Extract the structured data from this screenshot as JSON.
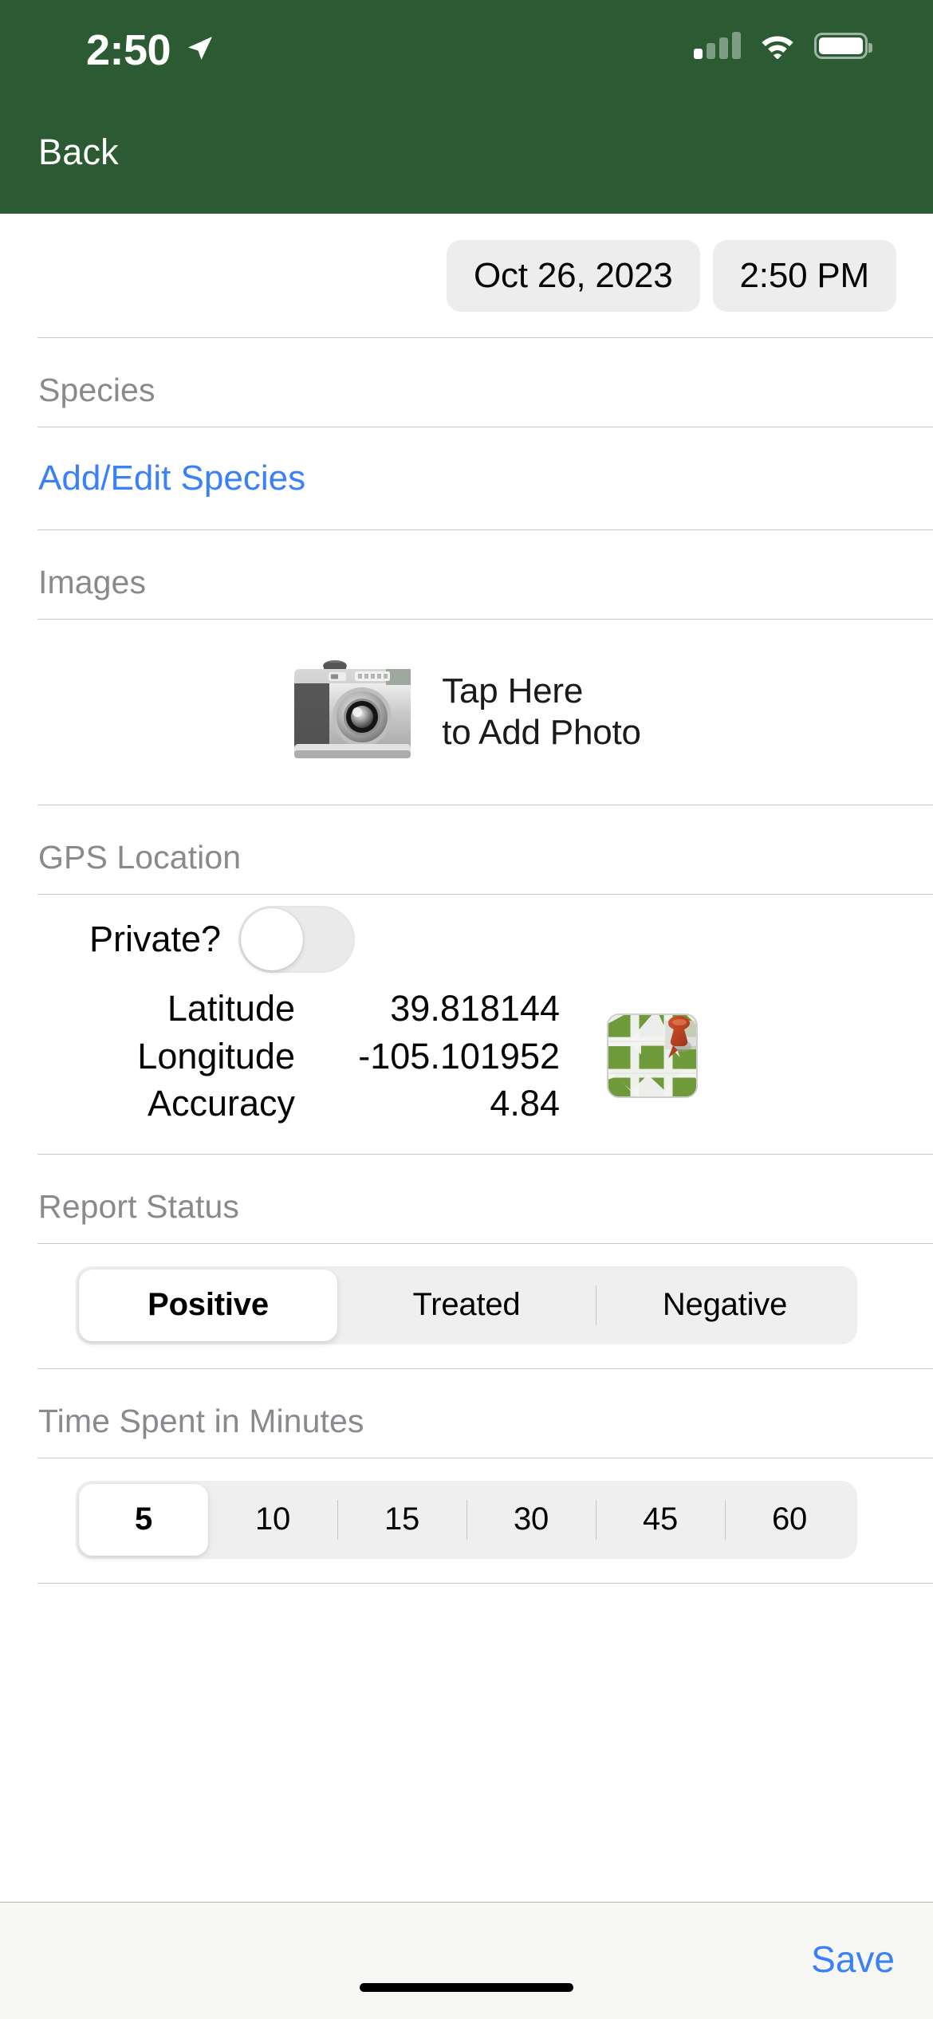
{
  "status_bar": {
    "time": "2:50",
    "location_arrow_icon": "location-arrow-icon",
    "signal_icon": "cellular-signal-icon",
    "signal_bars_active": 1,
    "signal_bars_total": 4,
    "wifi_icon": "wifi-icon",
    "battery_icon": "battery-icon",
    "battery_level_percent": 100
  },
  "nav": {
    "back_label": "Back",
    "bar_color": "#2C5B33"
  },
  "datetime": {
    "date_value": "Oct 26, 2023",
    "time_value": "2:50 PM"
  },
  "species": {
    "section_label": "Species",
    "add_edit_link": "Add/Edit Species"
  },
  "images": {
    "section_label": "Images",
    "camera_icon": "camera-icon",
    "tap_line1": "Tap Here",
    "tap_line2": "to Add Photo"
  },
  "gps": {
    "section_label": "GPS Location",
    "private_label": "Private?",
    "private_on": false,
    "rows": [
      {
        "key": "Latitude",
        "value": "39.818144"
      },
      {
        "key": "Longitude",
        "value": "-105.101952"
      },
      {
        "key": "Accuracy",
        "value": "4.84"
      }
    ],
    "map_icon": "map-pin-icon"
  },
  "report_status": {
    "section_label": "Report Status",
    "options": [
      "Positive",
      "Treated",
      "Negative"
    ],
    "selected": "Positive"
  },
  "time_spent": {
    "section_label": "Time Spent in Minutes",
    "options": [
      "5",
      "10",
      "15",
      "30",
      "45",
      "60"
    ],
    "selected": "5"
  },
  "footer": {
    "save_label": "Save"
  },
  "colors": {
    "header_green": "#2C5B33",
    "link_blue": "#3A80F8",
    "section_label_gray": "#8A8A8E",
    "segment_track": "#EFEFF0"
  }
}
